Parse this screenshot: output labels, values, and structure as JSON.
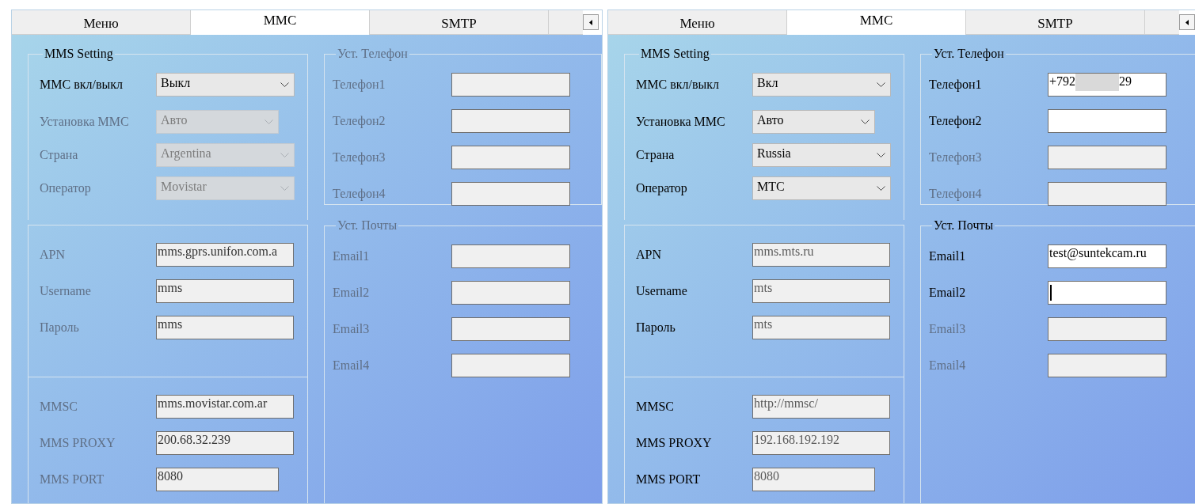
{
  "panels": [
    {
      "tabs": [
        {
          "label": "Меню",
          "selected": false
        },
        {
          "label": "MMC",
          "selected": true
        },
        {
          "label": "SMTP",
          "selected": false
        }
      ],
      "mms_setting": {
        "title": "MMS Setting",
        "disabled": false,
        "rows": [
          {
            "label": "MMC вкл/выкл",
            "value": "Выкл",
            "disabled": false,
            "narrow": false
          },
          {
            "label": "Установка MMC",
            "value": "Авто",
            "disabled": true,
            "narrow": true
          },
          {
            "label": "Страна",
            "value": "Argentina",
            "disabled": true,
            "narrow": false
          },
          {
            "label": "Оператор",
            "value": "Movistar",
            "disabled": true,
            "narrow": false
          }
        ]
      },
      "apn_fields": [
        {
          "label": "APN",
          "value": "mms.gprs.unifon.com.a",
          "disabled": true,
          "readonly": false
        },
        {
          "label": "Username",
          "value": "mms",
          "disabled": true,
          "readonly": false
        },
        {
          "label": "Пароль",
          "value": "mms",
          "disabled": true,
          "readonly": false
        }
      ],
      "mmsc_fields": [
        {
          "label": "MMSC",
          "value": "mms.movistar.com.ar",
          "disabled": true,
          "readonly": false,
          "narrow": false
        },
        {
          "label": "MMS PROXY",
          "value": "200.68.32.239",
          "disabled": true,
          "readonly": false,
          "narrow": false
        },
        {
          "label": "MMS PORT",
          "value": "8080",
          "disabled": true,
          "readonly": false,
          "narrow": true
        }
      ],
      "phones": {
        "title": "Уст. Телефон",
        "disabled": true,
        "fields": [
          {
            "label": "Телефон1",
            "disabled": true
          },
          {
            "label": "Телефон2",
            "disabled": true
          },
          {
            "label": "Телефон3",
            "disabled": true
          },
          {
            "label": "Телефон4",
            "disabled": true
          }
        ]
      },
      "emails": {
        "title": "Уст. Почты",
        "disabled": true,
        "fields": [
          {
            "label": "Email1",
            "disabled": true
          },
          {
            "label": "Email2",
            "disabled": true
          },
          {
            "label": "Email3",
            "disabled": true
          },
          {
            "label": "Email4",
            "disabled": true
          }
        ]
      }
    },
    {
      "tabs": [
        {
          "label": "Меню",
          "selected": false
        },
        {
          "label": "MMC",
          "selected": true
        },
        {
          "label": "SMTP",
          "selected": false
        }
      ],
      "mms_setting": {
        "title": "MMS Setting",
        "disabled": false,
        "rows": [
          {
            "label": "MMC вкл/выкл",
            "value": "Вкл",
            "disabled": false,
            "narrow": false
          },
          {
            "label": "Установка MMC",
            "value": "Авто",
            "disabled": false,
            "narrow": true
          },
          {
            "label": "Страна",
            "value": "Russia",
            "disabled": false,
            "narrow": false
          },
          {
            "label": "Оператор",
            "value": "MTC",
            "disabled": false,
            "narrow": false
          }
        ]
      },
      "apn_fields": [
        {
          "label": "APN",
          "value": "mms.mts.ru",
          "disabled": false,
          "readonly": true
        },
        {
          "label": "Username",
          "value": "mts",
          "disabled": false,
          "readonly": true
        },
        {
          "label": "Пароль",
          "value": "mts",
          "disabled": false,
          "readonly": true
        }
      ],
      "mmsc_fields": [
        {
          "label": "MMSC",
          "value": "http://mmsc/",
          "disabled": false,
          "readonly": true,
          "narrow": false
        },
        {
          "label": "MMS PROXY",
          "value": "192.168.192.192",
          "disabled": false,
          "readonly": true,
          "narrow": false
        },
        {
          "label": "MMS PORT",
          "value": "8080",
          "disabled": false,
          "readonly": true,
          "narrow": true
        }
      ],
      "phones": {
        "title": "Уст. Телефон",
        "disabled": false,
        "fields": [
          {
            "label": "Телефон1",
            "value": "+792",
            "suffix": "29",
            "disabled": false
          },
          {
            "label": "Телефон2",
            "disabled": false
          },
          {
            "label": "Телефон3",
            "disabled": true
          },
          {
            "label": "Телефон4",
            "disabled": true
          }
        ]
      },
      "emails": {
        "title": "Уст. Почты",
        "disabled": false,
        "fields": [
          {
            "label": "Email1",
            "value": "test@suntekcam.ru",
            "disabled": false
          },
          {
            "label": "Email2",
            "disabled": false,
            "focused": true
          },
          {
            "label": "Email3",
            "disabled": true
          },
          {
            "label": "Email4",
            "disabled": true
          }
        ]
      }
    }
  ]
}
